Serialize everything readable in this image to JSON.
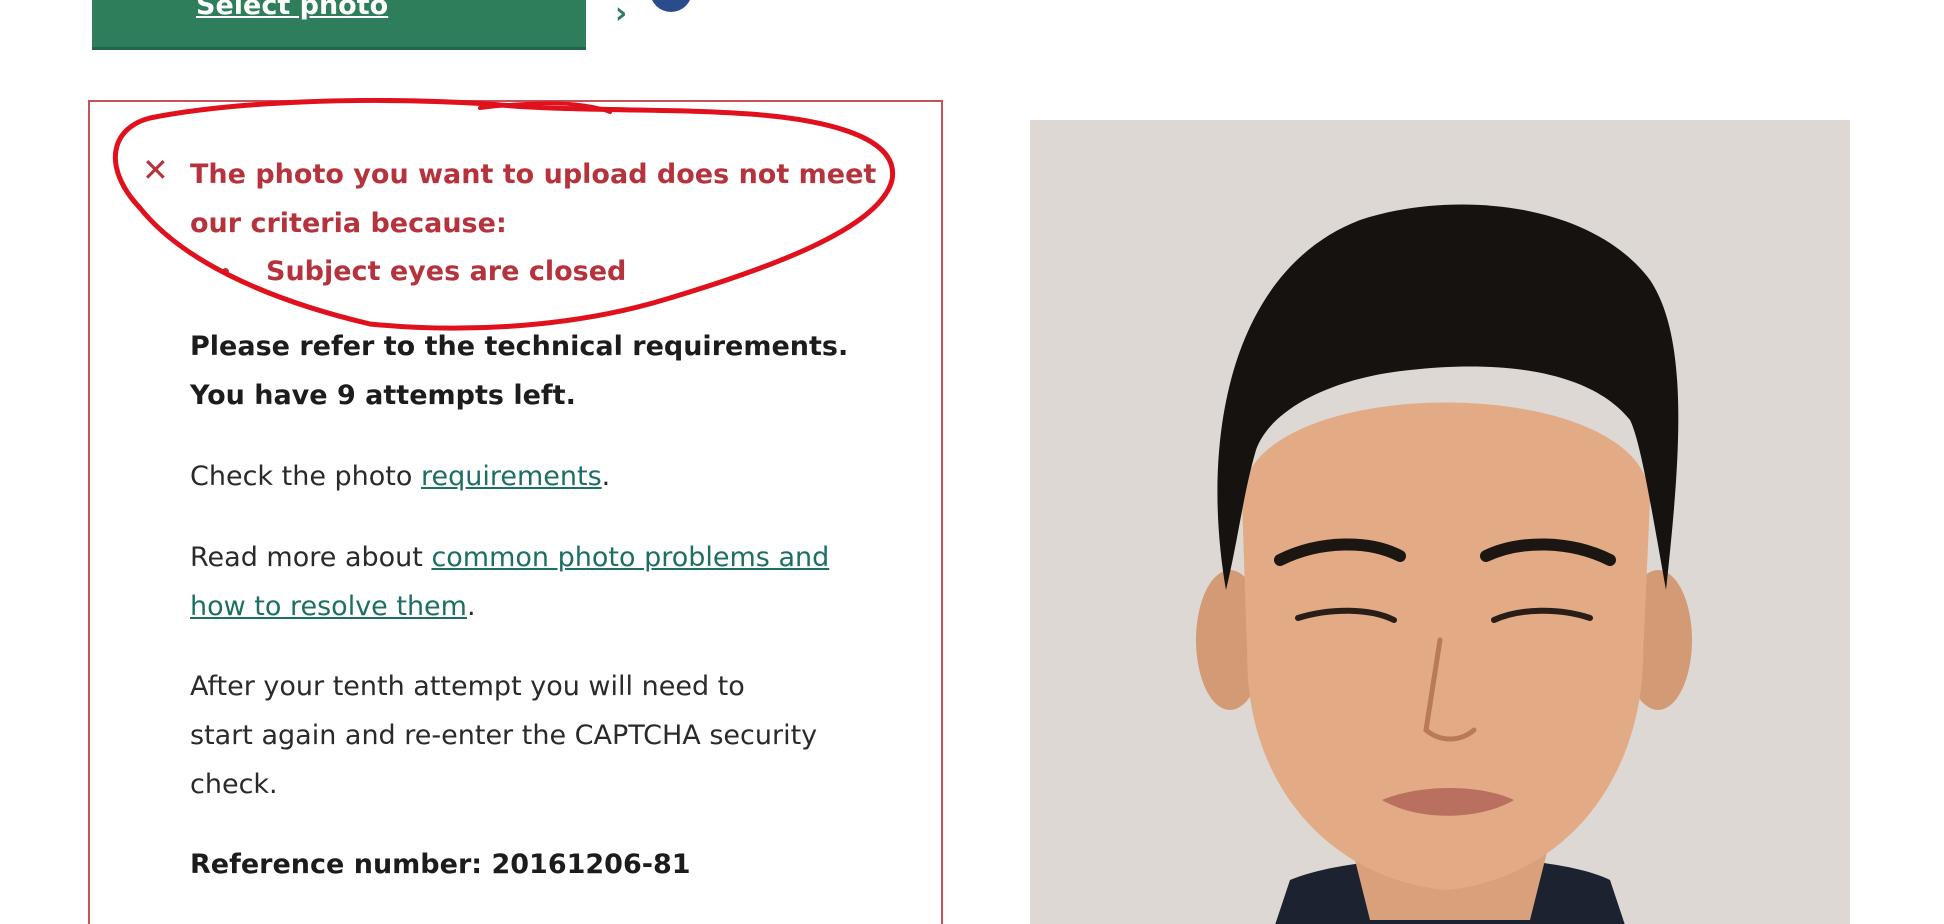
{
  "toolbar": {
    "select_photo_label": "Select photo",
    "select_photo_icon": "chevron-right-icon",
    "help_icon": "question-circle-icon"
  },
  "error": {
    "icon": "close-icon",
    "message_line1": "The photo you want to upload does not meet",
    "message_line2": "our criteria because:",
    "reasons": [
      "Subject eyes are closed"
    ]
  },
  "info": {
    "tech_line": "Please refer to the technical requirements.",
    "attempts_line": "You have 9 attempts left.",
    "check_prefix": "Check the photo ",
    "check_link": "requirements",
    "check_suffix": ".",
    "read_prefix": "Read more about ",
    "read_link_line1": "common photo problems and",
    "read_link_line2": "how to resolve them",
    "read_suffix": ".",
    "after_line1": "After your tenth attempt you will need to",
    "after_line2": "start again and re-enter the CAPTCHA security",
    "after_line3": "check.",
    "reference_label": "Reference number: 20161206-81"
  },
  "colors": {
    "button_green": "#2e7d5b",
    "error_red": "#b5333d",
    "link_teal": "#1e6f63",
    "panel_border": "#c9525a",
    "annotation_red": "#e0101c"
  }
}
